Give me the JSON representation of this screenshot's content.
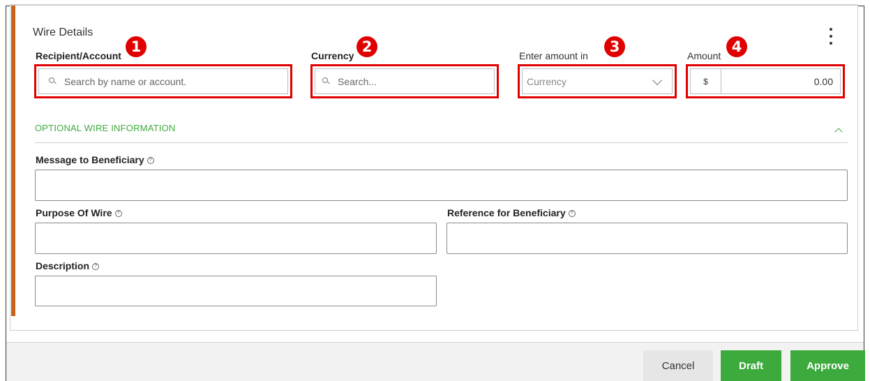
{
  "section": {
    "title": "Wire Details"
  },
  "fields": {
    "recipient": {
      "label": "Recipient/Account",
      "placeholder": "Search by name or account.",
      "badge": "1"
    },
    "currency": {
      "label": "Currency",
      "placeholder": "Search...",
      "badge": "2"
    },
    "enter_amount_in": {
      "label": "Enter amount in",
      "value": "Currency",
      "badge": "3"
    },
    "amount": {
      "label": "Amount",
      "symbol": "$",
      "value": "0.00",
      "badge": "4"
    }
  },
  "optional": {
    "title": "OPTIONAL WIRE INFORMATION",
    "message_label": "Message to Beneficiary",
    "purpose_label": "Purpose Of Wire",
    "reference_label": "Reference for Beneficiary",
    "description_label": "Description"
  },
  "help_glyph": "?",
  "footer": {
    "cancel": "Cancel",
    "draft": "Draft",
    "approve": "Approve"
  },
  "colors": {
    "accent_bar": "#c9631c",
    "highlight": "#e00000",
    "primary_green": "#3daa3d"
  },
  "icons": [
    "search-icon",
    "chevron-down-icon",
    "chevron-up-icon",
    "more-vertical-icon",
    "help-icon"
  ]
}
